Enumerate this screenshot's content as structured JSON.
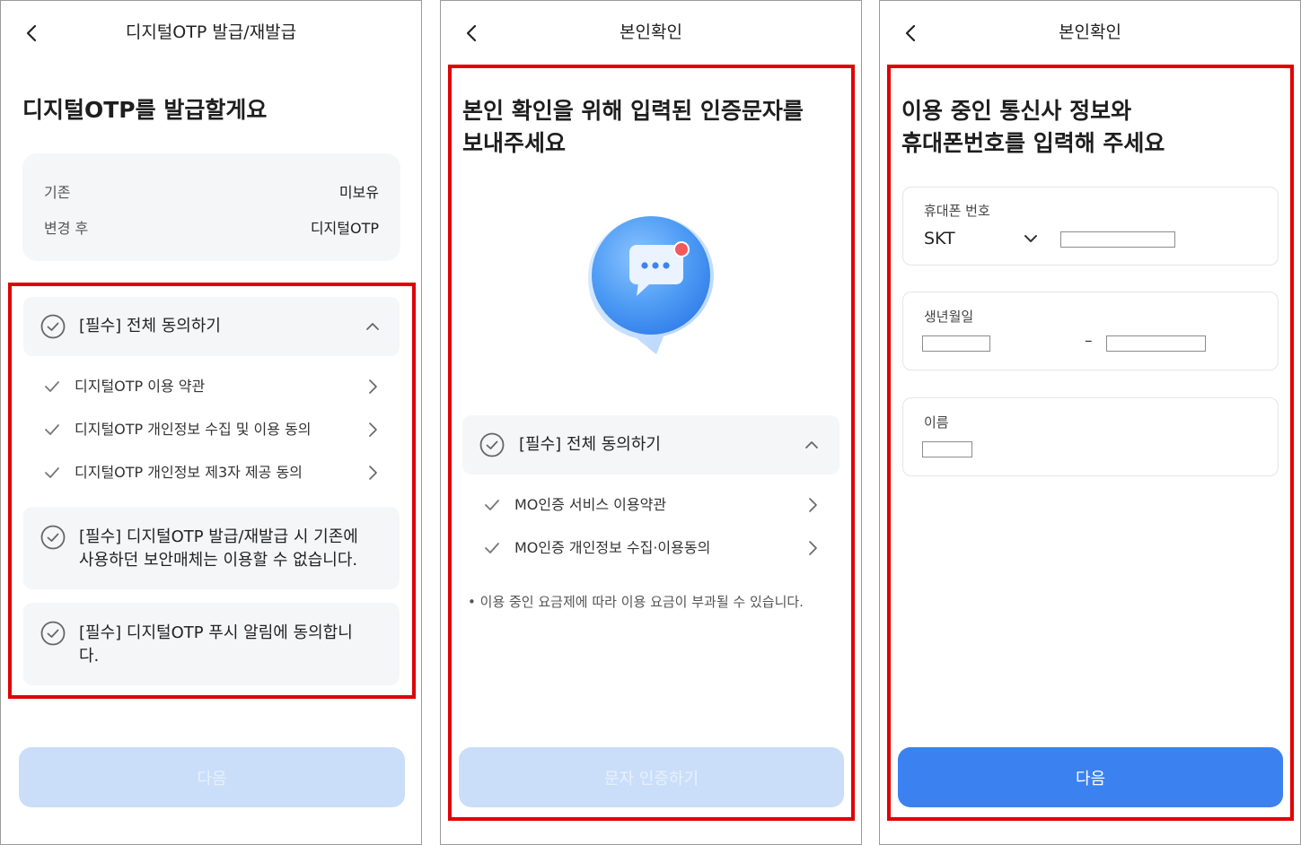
{
  "screen1": {
    "header_title": "디지털OTP 발급/재발급",
    "headline": "디지털OTP를 발급할게요",
    "info": {
      "row1_label": "기존",
      "row1_value": "미보유",
      "row2_label": "변경 후",
      "row2_value": "디지털OTP"
    },
    "agree_all": "[필수] 전체 동의하기",
    "terms": [
      "디지털OTP 이용 약관",
      "디지털OTP 개인정보 수집 및 이용 동의",
      "디지털OTP 개인정보 제3자 제공 동의"
    ],
    "consent1_line1": "[필수] 디지털OTP 발급/재발급 시 기존에",
    "consent1_line2": "사용하던 보안매체는 이용할 수 없습니다.",
    "consent2_line1": "[필수] 디지털OTP 푸시 알림에 동의합니",
    "consent2_line2": "다.",
    "button": "다음"
  },
  "screen2": {
    "header_title": "본인확인",
    "headline_line1": "본인 확인을 위해 입력된 인증문자를",
    "headline_line2": "보내주세요",
    "agree_all": "[필수] 전체 동의하기",
    "terms": [
      "MO인증 서비스 이용약관",
      "MO인증 개인정보 수집·이용동의"
    ],
    "note": "이용 중인 요금제에 따라 이용 요금이 부과될 수 있습니다.",
    "button": "문자 인증하기"
  },
  "screen3": {
    "header_title": "본인확인",
    "headline_line1": "이용 중인 통신사 정보와",
    "headline_line2": "휴대폰번호를 입력해 주세요",
    "phone_label": "휴대폰 번호",
    "carrier": "SKT",
    "phone_value": "",
    "birth_label": "생년월일",
    "birth_front": "",
    "birth_back": "",
    "name_label": "이름",
    "name_value": "",
    "button": "다음"
  },
  "colors": {
    "highlight": "#e00000",
    "primary": "#3b82f0",
    "disabled": "#cadefa",
    "card_bg": "#f5f6f8"
  }
}
